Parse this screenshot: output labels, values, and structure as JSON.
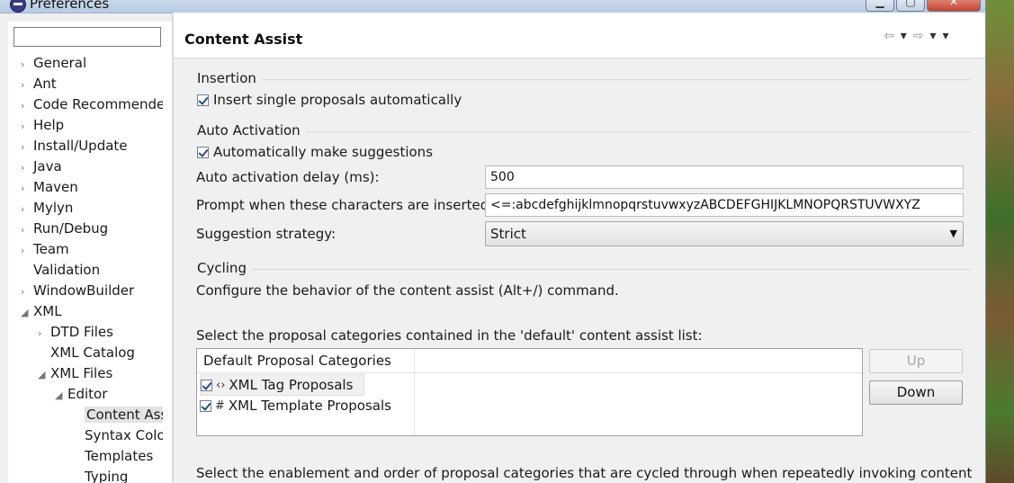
{
  "window": {
    "title": "Preferences",
    "minimize": "▁",
    "maximize": "▢",
    "close": "✕"
  },
  "sidebar": {
    "filter_placeholder": "",
    "items": [
      {
        "label": "General",
        "arrow": "›"
      },
      {
        "label": "Ant",
        "arrow": "›"
      },
      {
        "label": "Code Recommenders",
        "arrow": "›"
      },
      {
        "label": "Help",
        "arrow": "›"
      },
      {
        "label": "Install/Update",
        "arrow": "›"
      },
      {
        "label": "Java",
        "arrow": "›"
      },
      {
        "label": "Maven",
        "arrow": "›"
      },
      {
        "label": "Mylyn",
        "arrow": "›"
      },
      {
        "label": "Run/Debug",
        "arrow": "›"
      },
      {
        "label": "Team",
        "arrow": "›"
      },
      {
        "label": "Validation",
        "arrow": ""
      },
      {
        "label": "WindowBuilder",
        "arrow": "›"
      },
      {
        "label": "XML",
        "arrow": "◢"
      },
      {
        "label": "DTD Files",
        "arrow": "›"
      },
      {
        "label": "XML Catalog",
        "arrow": ""
      },
      {
        "label": "XML Files",
        "arrow": "◢"
      },
      {
        "label": "Editor",
        "arrow": "◢"
      },
      {
        "label": "Content Assist",
        "arrow": ""
      },
      {
        "label": "Syntax Coloring",
        "arrow": ""
      },
      {
        "label": "Templates",
        "arrow": ""
      },
      {
        "label": "Typing",
        "arrow": ""
      }
    ]
  },
  "page": {
    "title": "Content Assist",
    "nav": {
      "back": "⇦",
      "back_menu": "▾",
      "forward": "⇨",
      "forward_menu": "▾",
      "view_menu": "▾"
    }
  },
  "insertion": {
    "label": "Insertion",
    "insert_single": {
      "label": "Insert single proposals automatically",
      "checked": true
    }
  },
  "auto_activation": {
    "label": "Auto Activation",
    "make_suggestions": {
      "label": "Automatically make suggestions",
      "checked": true
    },
    "delay_label": "Auto activation delay (ms):",
    "delay_value": "500",
    "prompt_label": "Prompt when these characters are inserted:",
    "prompt_value": "<=:abcdefghijklmnopqrstuvwxyzABCDEFGHIJKLMNOPQRSTUVWXYZ",
    "strategy_label": "Suggestion strategy:",
    "strategy_value": "Strict",
    "strategy_arrow": "▼"
  },
  "cycling": {
    "label": "Cycling",
    "description": "Configure the behavior of the content assist (Alt+/) command.",
    "default_list_label": "Select the proposal categories contained in the 'default' content assist list:",
    "table": {
      "header": "Default Proposal Categories",
      "rows": [
        {
          "icon": "‹›",
          "label": "XML Tag Proposals",
          "checked": true
        },
        {
          "icon": "#",
          "label": "XML Template Proposals",
          "checked": true
        }
      ]
    },
    "up_button": "Up",
    "down_button": "Down",
    "cycle_label": "Select the enablement and order of proposal categories that are cycled through when repeatedly invoking content"
  }
}
